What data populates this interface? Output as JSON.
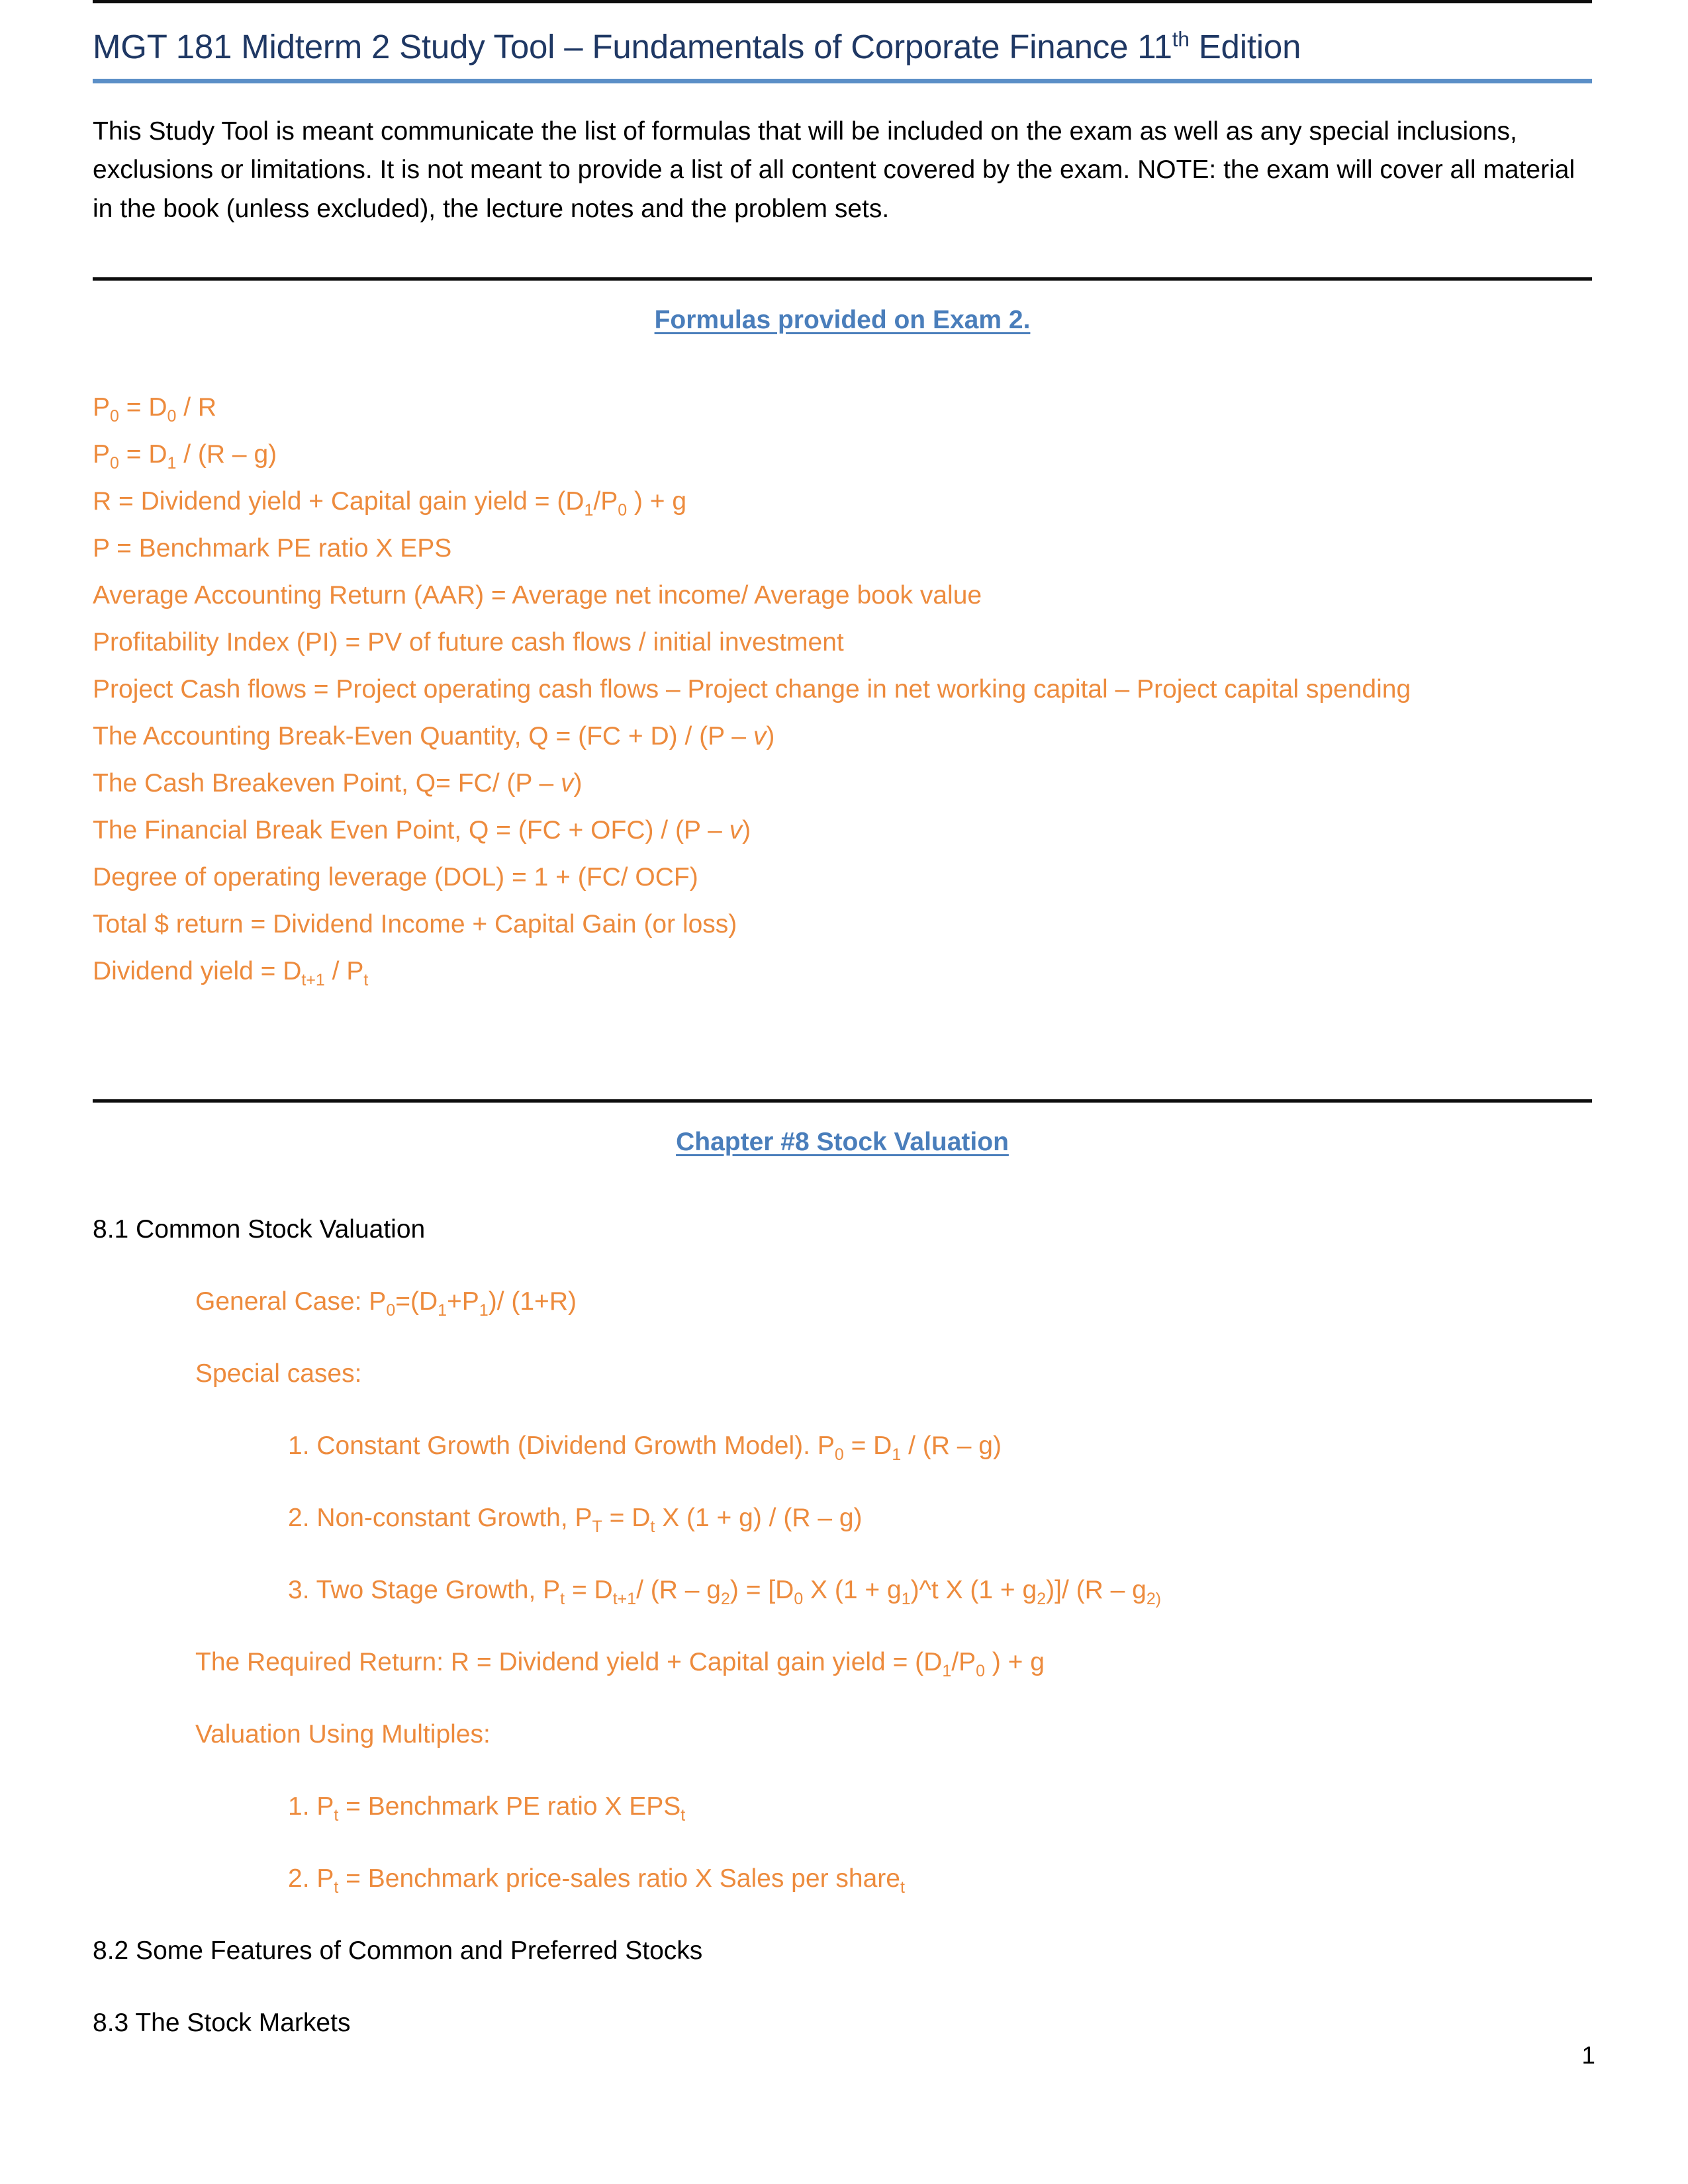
{
  "document": {
    "title_prefix": "MGT 181 Midterm 2 Study Tool – Fundamentals of Corporate Finance 11",
    "title_sup": "th",
    "title_suffix": " Edition",
    "page_number": "1"
  },
  "intro": {
    "paragraph": "This Study Tool is meant communicate the list of formulas that will be included on the exam as well as any special inclusions, exclusions or limitations. It is not meant to provide a list of all content covered by the exam.  NOTE: the exam will cover all material in the book (unless excluded), the lecture notes and the problem sets."
  },
  "formulas_section": {
    "heading": "Formulas provided on Exam 2.",
    "items": [
      {
        "parts": [
          {
            "t": "P"
          },
          {
            "sub": "0"
          },
          {
            "t": " = D"
          },
          {
            "sub": "0"
          },
          {
            "t": " / R"
          }
        ]
      },
      {
        "parts": [
          {
            "t": "P"
          },
          {
            "sub": "0"
          },
          {
            "t": " = D"
          },
          {
            "sub": "1"
          },
          {
            "t": " / (R – g)"
          }
        ]
      },
      {
        "parts": [
          {
            "t": "R = Dividend yield + Capital gain yield =  (D"
          },
          {
            "sub": "1"
          },
          {
            "t": "/P"
          },
          {
            "sub": "0"
          },
          {
            "t": " ) + g"
          }
        ]
      },
      {
        "parts": [
          {
            "t": "P = Benchmark PE ratio X EPS"
          }
        ]
      },
      {
        "parts": [
          {
            "t": "Average Accounting Return (AAR) = Average net income/ Average book value"
          }
        ]
      },
      {
        "parts": [
          {
            "t": "Profitability Index (PI) = PV of future cash flows / initial investment"
          }
        ]
      },
      {
        "parts": [
          {
            "t": "Project Cash flows = Project operating cash flows – Project change in net working capital – Project capital spending"
          }
        ]
      },
      {
        "parts": [
          {
            "t": "The Accounting Break-Even Quantity, Q = (FC + D) / (P – "
          },
          {
            "i": "v"
          },
          {
            "t": ")"
          }
        ]
      },
      {
        "parts": [
          {
            "t": "The Cash Breakeven Point, Q= FC/ (P – "
          },
          {
            "i": "v"
          },
          {
            "t": ")"
          }
        ]
      },
      {
        "parts": [
          {
            "t": "The Financial Break Even Point, Q = (FC + OFC) / (P – "
          },
          {
            "i": "v"
          },
          {
            "t": ")"
          }
        ]
      },
      {
        "parts": [
          {
            "t": "Degree of operating leverage (DOL) = 1 + (FC/ OCF)"
          }
        ]
      },
      {
        "parts": [
          {
            "t": "Total $ return = Dividend Income + Capital Gain (or loss)"
          }
        ]
      },
      {
        "parts": [
          {
            "t": "Dividend yield = D"
          },
          {
            "sub": "t+1"
          },
          {
            "t": " / P"
          },
          {
            "sub": "t"
          }
        ]
      }
    ]
  },
  "chapter8": {
    "heading": "Chapter #8 Stock Valuation",
    "sub_8_1": "8.1 Common Stock Valuation",
    "general_case": {
      "parts": [
        {
          "t": "General Case: P"
        },
        {
          "sub": "0"
        },
        {
          "t": "=(D"
        },
        {
          "sub": "1"
        },
        {
          "t": "+P"
        },
        {
          "sub": "1"
        },
        {
          "t": ")/ (1+R)"
        }
      ]
    },
    "special_cases_label": "Special cases:",
    "special_cases": [
      {
        "parts": [
          {
            "t": "1. Constant Growth (Dividend Growth Model). P"
          },
          {
            "sub": "0"
          },
          {
            "t": " = D"
          },
          {
            "sub": "1"
          },
          {
            "t": " / (R – g)"
          }
        ]
      },
      {
        "parts": [
          {
            "t": "2. Non-constant Growth, P"
          },
          {
            "sub": "T"
          },
          {
            "t": " = D"
          },
          {
            "sub": "t"
          },
          {
            "t": " X (1 + g) / (R – g)"
          }
        ]
      },
      {
        "parts": [
          {
            "t": "3. Two Stage Growth, P"
          },
          {
            "sub": "t"
          },
          {
            "t": " = D"
          },
          {
            "sub": "t+1"
          },
          {
            "t": "/ (R – g"
          },
          {
            "sub": "2"
          },
          {
            "t": ") = [D"
          },
          {
            "sub": "0"
          },
          {
            "t": " X (1 + g"
          },
          {
            "sub": "1"
          },
          {
            "t": ")^t X (1 + g"
          },
          {
            "sub": "2"
          },
          {
            "t": ")]/ (R –  g"
          },
          {
            "sub": "2)"
          }
        ]
      }
    ],
    "required_return": {
      "parts": [
        {
          "t": "The Required Return: R = Dividend yield + Capital gain yield =  (D"
        },
        {
          "sub": "1"
        },
        {
          "t": "/P"
        },
        {
          "sub": "0"
        },
        {
          "t": " ) + g"
        }
      ]
    },
    "valuation_multiples_label": "Valuation Using Multiples:",
    "valuation_multiples": [
      {
        "parts": [
          {
            "t": "1. P"
          },
          {
            "sub": "t"
          },
          {
            "t": " = Benchmark PE ratio X EPS"
          },
          {
            "sub": "t"
          }
        ]
      },
      {
        "parts": [
          {
            "t": "2. P"
          },
          {
            "sub": "t"
          },
          {
            "t": " = Benchmark price-sales ratio X Sales per share"
          },
          {
            "sub": "t"
          }
        ]
      }
    ],
    "sub_8_2": "8.2 Some Features of Common and Preferred Stocks",
    "sub_8_3": "8.3 The Stock Markets"
  },
  "colors": {
    "title_blue": "#1f3864",
    "heading_blue": "#4a7ebb",
    "formula_orange": "#ed8b3d",
    "rule_black": "#0d0d0d",
    "rule_blue": "#5b8fc7"
  }
}
